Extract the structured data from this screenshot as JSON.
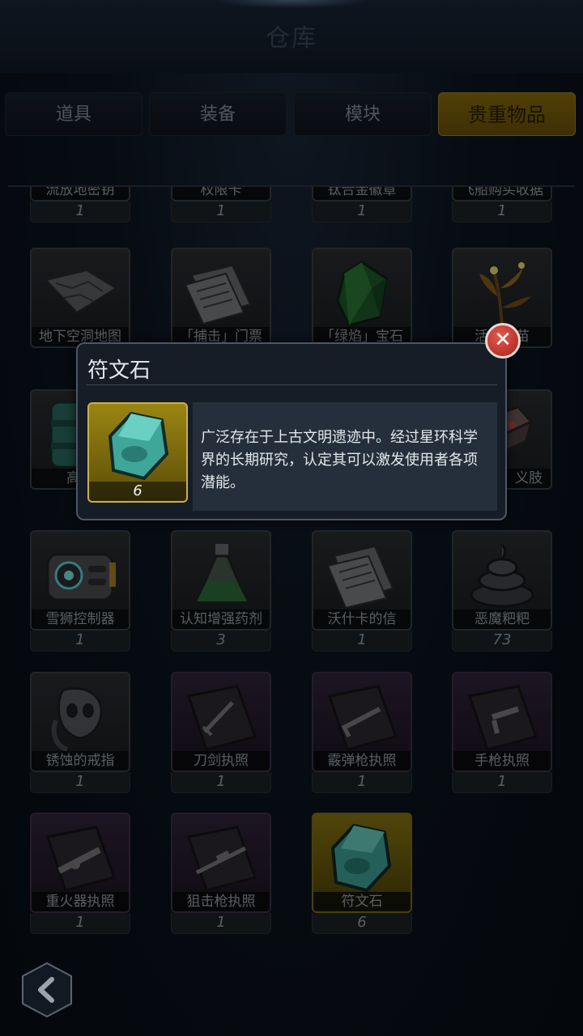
{
  "header": {
    "title": "仓库"
  },
  "tabs": [
    {
      "label": "道具"
    },
    {
      "label": "装备"
    },
    {
      "label": "模块"
    },
    {
      "label": "贵重物品",
      "active": true
    }
  ],
  "items": [
    {
      "name": "流放地密钥",
      "count": "1",
      "icon": "key-icon"
    },
    {
      "name": "权限卡",
      "count": "1",
      "icon": "card-icon"
    },
    {
      "name": "钛合金徽章",
      "count": "1",
      "icon": "badge-icon"
    },
    {
      "name": "飞船购买收据",
      "count": "1",
      "icon": "receipt-icon"
    },
    {
      "name": "地下空洞地图",
      "count": "",
      "icon": "map-icon"
    },
    {
      "name": "「捕击」门票",
      "count": "",
      "icon": "document-icon"
    },
    {
      "name": "「绿焰」宝石",
      "count": "",
      "icon": "green-gem-icon"
    },
    {
      "name": "活力草苗",
      "count": "",
      "icon": "plant-icon"
    },
    {
      "name": "高爆",
      "count": "",
      "icon": "canister-icon"
    },
    {
      "name": "义肢",
      "count": "",
      "icon": "prosthetic-icon"
    },
    {
      "name": "雪狮控制器",
      "count": "1",
      "icon": "controller-icon"
    },
    {
      "name": "认知增强药剂",
      "count": "3",
      "icon": "flask-icon"
    },
    {
      "name": "沃什卡的信",
      "count": "1",
      "icon": "letter-icon"
    },
    {
      "name": "恶魔粑粑",
      "count": "73",
      "icon": "poop-icon"
    },
    {
      "name": "锈蚀的戒指",
      "count": "1",
      "icon": "skull-ring-icon"
    },
    {
      "name": "刀剑执照",
      "count": "1",
      "icon": "sword-license-icon"
    },
    {
      "name": "霰弹枪执照",
      "count": "1",
      "icon": "shotgun-license-icon"
    },
    {
      "name": "手枪执照",
      "count": "1",
      "icon": "pistol-license-icon"
    },
    {
      "name": "重火器执照",
      "count": "1",
      "icon": "heavy-weapon-license-icon"
    },
    {
      "name": "狙击枪执照",
      "count": "1",
      "icon": "sniper-license-icon"
    },
    {
      "name": "符文石",
      "count": "6",
      "icon": "rune-stone-icon"
    }
  ],
  "popup": {
    "title": "符文石",
    "count": "6",
    "description": "广泛存在于上古文明遗迹中。经过星环科学界的长期研究，认定其可以激发使用者各项潜能。",
    "icon": "rune-stone-icon"
  },
  "colors": {
    "accent_gold": "#8c6e10",
    "close_red": "#c8362e"
  }
}
